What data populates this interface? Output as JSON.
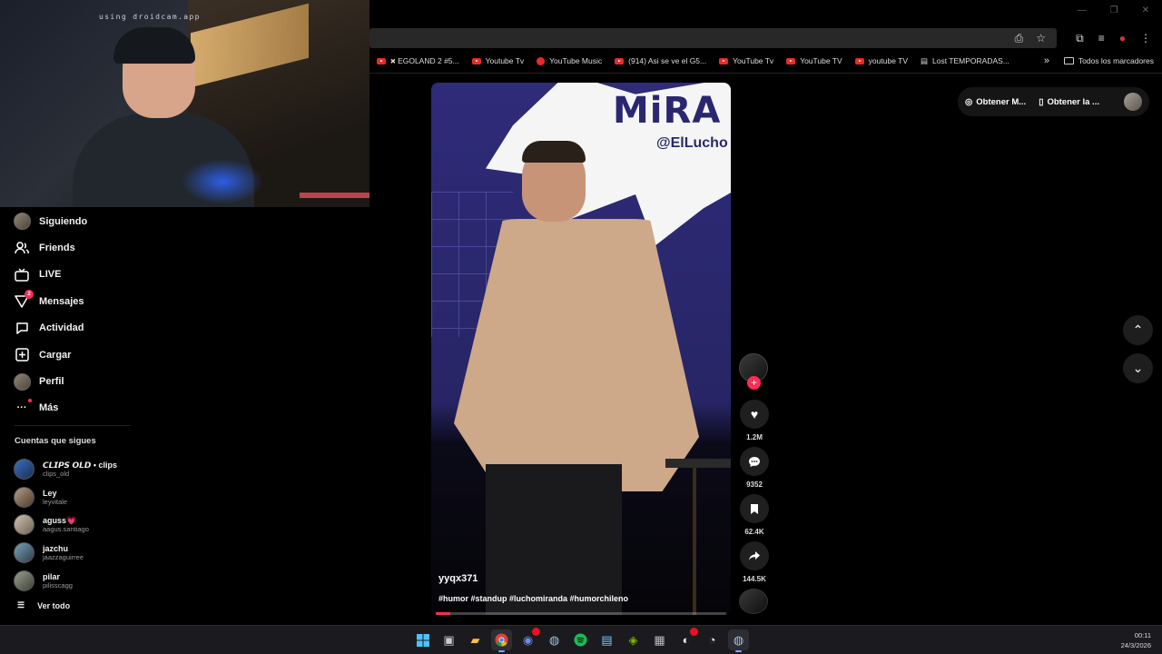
{
  "webcam": {
    "watermark": "using droidcam.app"
  },
  "bookmarks": [
    {
      "label": "🞭 EGOLAND 2 #5...",
      "icon": "youtube-icon"
    },
    {
      "label": "Youtube Tv",
      "icon": "youtube-icon"
    },
    {
      "label": "YouTube Music",
      "icon": "youtube-music-icon"
    },
    {
      "label": "(914) Asi se ve el G5...",
      "icon": "youtube-icon"
    },
    {
      "label": "YouTube Tv",
      "icon": "youtube-icon"
    },
    {
      "label": "YouTube TV",
      "icon": "youtube-icon"
    },
    {
      "label": "youtube TV",
      "icon": "youtube-icon"
    },
    {
      "label": "Lost TEMPORADAS...",
      "icon": "page-icon"
    }
  ],
  "bookmarks_more": "»",
  "bookmarks_folder": "Todos los marcadores",
  "nav": [
    {
      "label": "Siguiendo",
      "icon": "avatar"
    },
    {
      "label": "Friends",
      "icon": "friends-icon"
    },
    {
      "label": "LIVE",
      "icon": "live-icon"
    },
    {
      "label": "Mensajes",
      "icon": "messages-icon",
      "badge": "2"
    },
    {
      "label": "Actividad",
      "icon": "activity-icon"
    },
    {
      "label": "Cargar",
      "icon": "upload-icon"
    },
    {
      "label": "Perfil",
      "icon": "avatar"
    },
    {
      "label": "Más",
      "icon": "more-icon"
    }
  ],
  "following": {
    "title": "Cuentas que sigues",
    "accounts": [
      {
        "name": "𝘾𝙇𝙄𝙋𝙎 𝙊𝙇𝘿 • clips",
        "handle": "clips_old"
      },
      {
        "name": "Ley",
        "handle": "leyvitale"
      },
      {
        "name": "aguss💗",
        "handle": "aagus.santiago"
      },
      {
        "name": "jazchu",
        "handle": "jaazzaguirree"
      },
      {
        "name": "pilar",
        "handle": "pilisscagg"
      }
    ],
    "see_all": "Ver todo"
  },
  "video": {
    "overlay_title": "MiRA",
    "overlay_handle": "@ElLucho",
    "username": "yyqx371",
    "hashtags": "#humor #standup #luchomiranda #humorchileno",
    "progress": 0.05
  },
  "actions": {
    "likes": "1.2M",
    "comments": "9352",
    "saves": "62.4K",
    "shares": "144.5K"
  },
  "top_pill": {
    "coins": "Obtener M...",
    "app": "Obtener la ..."
  },
  "clock": {
    "time": "00:11",
    "date": "24/3/2026"
  },
  "colors": {
    "accent": "#fe2c55",
    "bg": "#000000"
  }
}
